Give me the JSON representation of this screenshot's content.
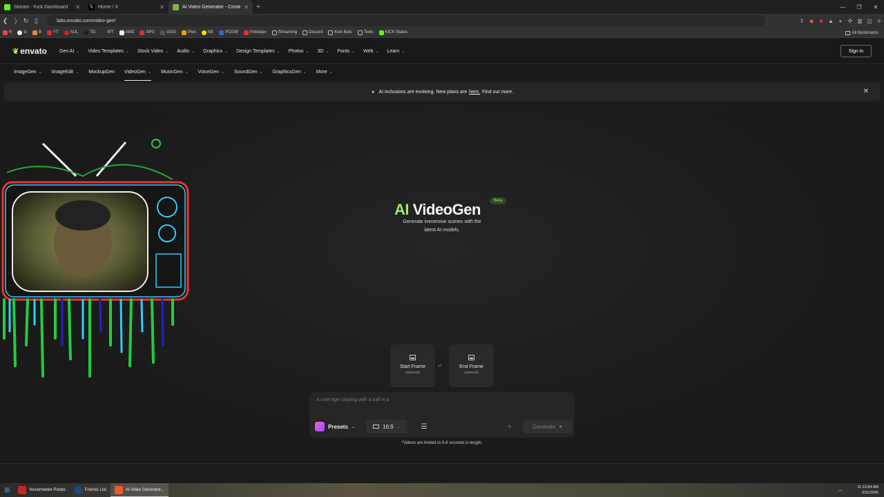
{
  "browser": {
    "tabs": [
      {
        "title": "Stream - Kick Dashboard",
        "color": "#53fc18",
        "active": false
      },
      {
        "title": "Home / X",
        "color": "#111111",
        "active": false
      },
      {
        "title": "AI Video Generator - Create Vid...",
        "color": "#82b440",
        "active": true
      }
    ],
    "url": "labs.envato.com/video-gen/",
    "bookmarks": [
      "R",
      "G",
      "B",
      "YT",
      "SUL",
      "TD",
      "IPT",
      "AMZ",
      "APG",
      "GOG",
      "Plex",
      "NE",
      "PCGW",
      "Polwizjer",
      "Streaming",
      "Discord",
      "Kick Bots",
      "Tools",
      "KICK Status"
    ],
    "all_bookmarks": "All Bookmarks"
  },
  "header": {
    "logo": "envato",
    "nav": [
      "Gen AI",
      "Video Templates",
      "Stock Video",
      "Audio",
      "Graphics",
      "Design Templates",
      "Photos",
      "3D",
      "Fonts",
      "Web",
      "Learn"
    ],
    "sign_in": "Sign in"
  },
  "subnav": [
    "ImageGen",
    "ImageEdit",
    "MockupGen",
    "VideoGen",
    "MusicGen",
    "VoiceGen",
    "SoundGen",
    "GraphicsGen",
    "More"
  ],
  "banner": {
    "text_before": "AI inclusions are evolving. New plans are",
    "link": "here.",
    "link2": "Find out more."
  },
  "hero": {
    "title_ai": "AI",
    "title_rest": " VideoGen",
    "badge": "Beta",
    "subtitle": "Generate immersive scenes with the latest AI models."
  },
  "frames": {
    "start_label": "Start Frame",
    "start_optional": "(optional)",
    "end_label": "End Frame",
    "end_optional": "(optional)"
  },
  "prompt": {
    "placeholder": "A cute tiger playing with a ball in a",
    "presets_label": "Presets",
    "ratio": "16:9",
    "generate_label": "Generate",
    "note": "*Videos are limited to 5-8 seconds in length."
  },
  "taskbar": {
    "items": [
      "Voicemeeter Potato",
      "Friends List",
      "AI Video Generator..."
    ],
    "time": "11:13:54 AM",
    "date": "3/11/2026"
  }
}
